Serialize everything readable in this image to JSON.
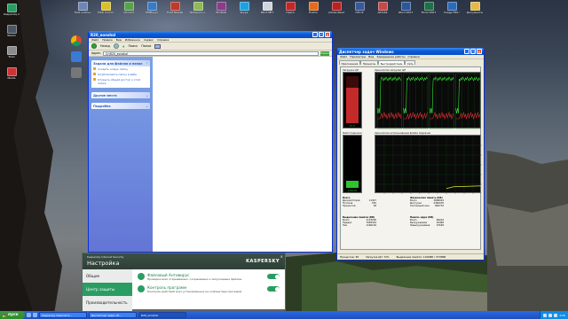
{
  "desktop_icons": [
    {
      "label": "Мой компьютер",
      "color": "#6e86b5"
    },
    {
      "label": "Total Commander",
      "color": "#d9c02c"
    },
    {
      "label": "uTorrent",
      "color": "#5aa24a"
    },
    {
      "label": "KMPlayer",
      "color": "#3a7bc8"
    },
    {
      "label": "Foxit Reader",
      "color": "#c0392b"
    },
    {
      "label": "Notepad++",
      "color": "#8fb85a"
    },
    {
      "label": "WinRAR",
      "color": "#8a3c8a"
    },
    {
      "label": "Skype",
      "color": "#1da1e0"
    },
    {
      "label": "Paint.NET",
      "color": "#d0d4dc"
    },
    {
      "label": "Opera",
      "color": "#c0282a"
    },
    {
      "label": "Firefox",
      "color": "#e36b1e"
    },
    {
      "label": "Adobe Reader",
      "color": "#b82222"
    },
    {
      "label": "CPU-Z",
      "color": "#3b5998"
    },
    {
      "label": "AIDA64",
      "color": "#c44a4a"
    },
    {
      "label": "Word 2007",
      "color": "#2b5797"
    },
    {
      "label": "Excel 2007",
      "color": "#1e7145"
    },
    {
      "label": "Image FRG S",
      "color": "#2d6bb8"
    },
    {
      "label": "Документы - ярлык",
      "color": "#e3b94a"
    },
    {
      "label": "Kaspersky Internet",
      "color": "#2a9d63"
    },
    {
      "label": "Steam",
      "color": "#4b5563"
    },
    {
      "label": "Tools",
      "color": "#8b8b8b"
    },
    {
      "label": "Media",
      "color": "#c33"
    }
  ],
  "explorer": {
    "title": "R20_eonshal",
    "menu": [
      "Файл",
      "Правка",
      "Вид",
      "Избранное",
      "Сервис",
      "Справка"
    ],
    "toolbar": {
      "back": "Назад",
      "search": "Поиск",
      "folders": "Папки"
    },
    "address_label": "Адрес:",
    "address_value": "D:\\R20_eonshal",
    "go": "Переход",
    "task_groups": [
      {
        "title": "Задачи для файлов и папок",
        "items": [
          "Создать новую папку",
          "Опубликовать папку в вебе",
          "Открыть общий доступ к этой папке"
        ]
      },
      {
        "title": "Другие места",
        "items": []
      },
      {
        "title": "Подробно",
        "items": []
      }
    ]
  },
  "taskmgr": {
    "title": "Диспетчер задач Windows",
    "menu": [
      "Файл",
      "Параметры",
      "Вид",
      "Завершение работы",
      "Справка"
    ],
    "tabs": [
      "Приложения",
      "Процессы",
      "Быстродействие",
      "Сеть"
    ],
    "active_tab": "Быстродействие",
    "cpu_load_label": "Загрузка ЦП",
    "cpu_history_label": "Хронология загрузки ЦП",
    "cpu_load_value": "72 %",
    "cpu_load_fraction": 0.72,
    "pf_label": "Файл подкачки",
    "pf_history_label": "Хронология использования файла подкачки",
    "pf_value": "1,08 ГБ",
    "pf_fraction": 0.14,
    "totals": {
      "title": "Всего",
      "rows": [
        [
          "Дескрипторов",
          "11307"
        ],
        [
          "Потоков",
          "555"
        ],
        [
          "Процессов",
          "38"
        ]
      ]
    },
    "physical": {
      "title": "Физическая память (КБ)",
      "rows": [
        [
          "Всего",
          "3668924"
        ],
        [
          "Доступно",
          "2382976"
        ],
        [
          "Системный кэш",
          "862732"
        ]
      ]
    },
    "commit": {
      "title": "Выделение памяти (КБ)",
      "rows": [
        [
          "Всего",
          "1133200"
        ],
        [
          "Предел",
          "7658344"
        ],
        [
          "Пик",
          "1166164"
        ]
      ]
    },
    "kernel": {
      "title": "Память ядра (КБ)",
      "rows": [
        [
          "Всего",
          "96016"
        ],
        [
          "Выгружаемая",
          "63468"
        ],
        [
          "Невыгружаемая",
          "32548"
        ]
      ]
    },
    "status": [
      "Процессов: 38",
      "Загрузка ЦП: 72%",
      "Выделение памяти: 1106МБ / 7478МБ"
    ]
  },
  "kaspersky": {
    "app": "Kaspersky Internet Security",
    "title": "Настройка",
    "logo": "KASPERSKY",
    "nav": [
      "Общие",
      "Центр защиты",
      "Производительность"
    ],
    "active_nav": "Центр защиты",
    "items": [
      {
        "name": "Файловый Антивирус",
        "desc": "Проверка всех открываемых, сохраняемых и запускаемых файлов."
      },
      {
        "name": "Контроль программ",
        "desc": "Контроль действий всех установленных на компьютере программ."
      }
    ]
  },
  "taskbar": {
    "start": "пуск",
    "buttons": [
      "Kaspersky Internet S...",
      "Диспетчер задач W...",
      "R20_eonshal"
    ],
    "active_button": "R20_eonshal",
    "clock": "4:06"
  }
}
